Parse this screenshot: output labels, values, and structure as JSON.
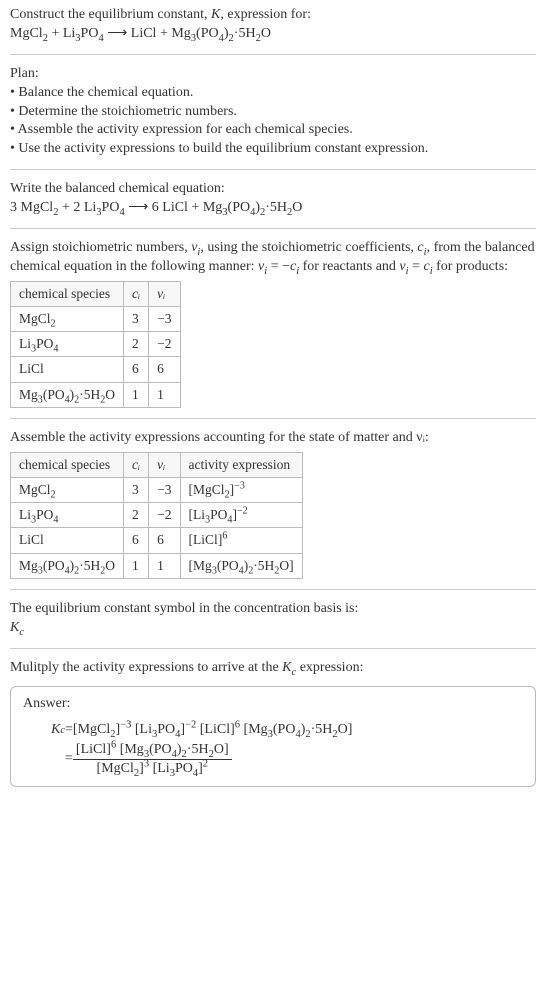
{
  "prompt": {
    "line1_a": "Construct the equilibrium constant, ",
    "line1_b": ", expression for:",
    "eq_lhs1": "MgCl",
    "eq_lhs1_sub": "2",
    "eq_plus": " + ",
    "eq_lhs2": "Li",
    "eq_lhs2_sub": "3",
    "eq_lhs3": "PO",
    "eq_lhs3_sub": "4",
    "eq_arr": "  ⟶  ",
    "eq_rhs1": "LiCl + Mg",
    "eq_rhs1_sub": "3",
    "eq_rhs2": "(PO",
    "eq_rhs2_sub": "4",
    "eq_rhs3": ")",
    "eq_rhs3_sub": "2",
    "eq_rhs4": "·5H",
    "eq_rhs4_sub": "2",
    "eq_rhs5": "O"
  },
  "plan": {
    "title": "Plan:",
    "b1": "• Balance the chemical equation.",
    "b2": "• Determine the stoichiometric numbers.",
    "b3": "• Assemble the activity expression for each chemical species.",
    "b4": "• Use the activity expressions to build the equilibrium constant expression."
  },
  "balanced": {
    "title": "Write the balanced chemical equation:",
    "p1": "3 MgCl",
    "p1s": "2",
    "p2": " + 2 Li",
    "p2s": "3",
    "p3": "PO",
    "p3s": "4",
    "arr": "  ⟶  ",
    "p4": "6 LiCl + Mg",
    "p4s": "3",
    "p5": "(PO",
    "p5s": "4",
    "p6": ")",
    "p6s": "2",
    "p7": "·5H",
    "p7s": "2",
    "p8": "O"
  },
  "stoich_intro": {
    "a": "Assign stoichiometric numbers, ",
    "nu": "ν",
    "i": "i",
    "b": ", using the stoichiometric coefficients, ",
    "c": "c",
    "d": ", from the balanced chemical equation in the following manner: ",
    "eq1a": "ν",
    "eq1b": " = −",
    "eq1c": "c",
    "e": " for reactants and ",
    "eq2a": "ν",
    "eq2b": " = ",
    "eq2c": "c",
    "f": " for products:"
  },
  "table1": {
    "h1": "chemical species",
    "h2": "cᵢ",
    "h3": "νᵢ",
    "r1c2": "3",
    "r1c3": "−3",
    "r2c2": "2",
    "r2c3": "−2",
    "r3c2": "6",
    "r3c3": "6",
    "r4c2": "1",
    "r4c3": "1"
  },
  "assemble_intro": "Assemble the activity expressions accounting for the state of matter and νᵢ:",
  "table2": {
    "h1": "chemical species",
    "h2": "cᵢ",
    "h3": "νᵢ",
    "h4": "activity expression",
    "r1c2": "3",
    "r1c3": "−3",
    "r2c2": "2",
    "r2c3": "−2",
    "r3c2": "6",
    "r3c3": "6",
    "r4c2": "1",
    "r4c3": "1"
  },
  "kc_text1": "The equilibrium constant symbol in the concentration basis is:",
  "kc_K": "K",
  "kc_c": "c",
  "multiply": "Mulitply the activity expressions to arrive at the ",
  "multiply_b": " expression:",
  "answer": {
    "label": "Answer:",
    "eq_lead": " = ",
    "frac_eq": " = "
  },
  "sp": {
    "mgcl2_a": "MgCl",
    "mgcl2_s": "2",
    "li3po4_a": "Li",
    "li3po4_s1": "3",
    "li3po4_b": "PO",
    "li3po4_s2": "4",
    "licl": "LiCl",
    "mg3po42_a": "Mg",
    "mg3po42_s1": "3",
    "mg3po42_b": "(PO",
    "mg3po42_s2": "4",
    "mg3po42_c": ")",
    "mg3po42_s3": "2",
    "mg3po42_d": "·5H",
    "mg3po42_s4": "2",
    "mg3po42_e": "O"
  },
  "exp": {
    "m3": "−3",
    "m2": "−2",
    "p6": "6",
    "p3": "3",
    "p2": "2"
  }
}
